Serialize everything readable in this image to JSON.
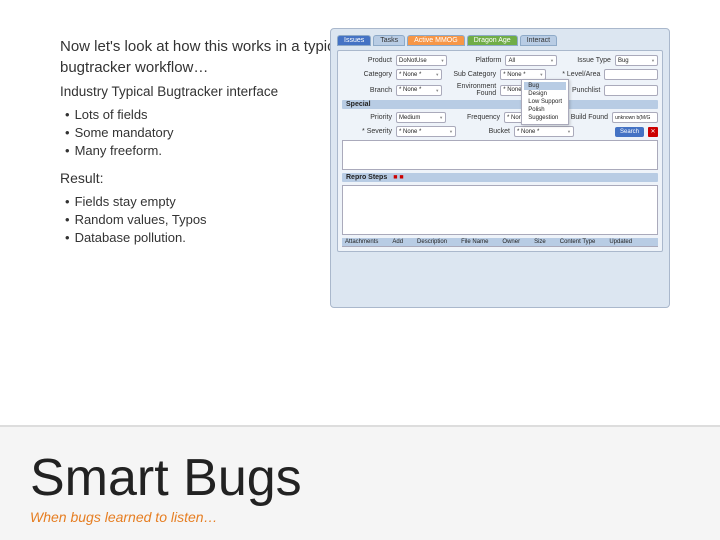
{
  "slide": {
    "top_text": "Now let's look at how this works in a typical bugtracker workflow…",
    "industry_label": "Industry  Typical Bugtracker interface",
    "bullets_group1": {
      "header": "Lots of fields",
      "items": [
        "Lots of fields",
        "Some mandatory",
        "Many freeform."
      ]
    },
    "result_label": "Result:",
    "bullets_group2": {
      "items": [
        "Fields stay empty",
        "Random values, Typos",
        "Database pollution."
      ]
    },
    "bottom": {
      "title": "Smart Bugs",
      "subtitle": "When bugs learned to listen…"
    }
  },
  "bugtracker": {
    "tabs": [
      "Issues",
      "Tasks",
      "Active MMOG",
      "Dragon Age",
      "Interact"
    ],
    "fields": {
      "product": "DoNotUse",
      "category": "* None *",
      "branch": "* None *",
      "platform": "All",
      "sub_category": "* None *",
      "environment_found": "* None *",
      "issue_type": "Bug",
      "level_area": "",
      "punchlist": "",
      "priority": "Medium",
      "frequency": "* None *",
      "build_found": "unknown b(M/G",
      "severity": "* None *",
      "bucket": "* None *"
    },
    "dropdown_options": [
      "Bug",
      "Design",
      "Low Support",
      "Polish",
      "Suggestion"
    ],
    "sections": {
      "special": "Special",
      "repro_steps": "Repro Steps",
      "attachments": "Attachments"
    },
    "attach_cols": [
      "Add",
      "Description",
      "File Name",
      "Owner",
      "Size",
      "Content Type",
      "Updated"
    ]
  }
}
